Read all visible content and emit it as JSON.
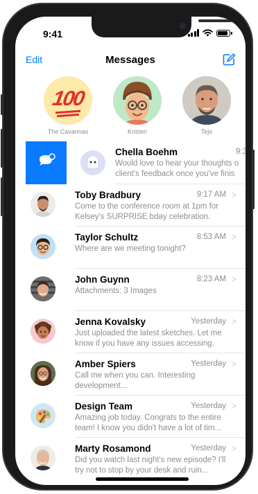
{
  "status": {
    "time": "9:41"
  },
  "nav": {
    "edit": "Edit",
    "title": "Messages"
  },
  "pins": [
    {
      "label": "The Cavannas",
      "emoji": "💯"
    },
    {
      "label": "Kristen"
    },
    {
      "label": "Tejo"
    }
  ],
  "swiped": {
    "name": "Chella Boehm",
    "time": "9:3",
    "preview_line1": "Would love to hear your thoughts o",
    "preview_line2": "client's feedback once you've finis"
  },
  "conversations": [
    {
      "name": "Toby Bradbury",
      "time": "9:17 AM",
      "preview": "Come to the conference room at 1pm for Kelsey's SURPRISE bday celebration."
    },
    {
      "name": "Taylor Schultz",
      "time": "8:53 AM",
      "preview": "Where are we meeting tonight?"
    },
    {
      "name": "John Guynn",
      "time": "8:23 AM",
      "preview": "Attachments: 3 Images"
    },
    {
      "name": "Jenna Kovalsky",
      "time": "Yesterday",
      "preview": "Just uploaded the latest sketches. Let me know if you have any issues accessing."
    },
    {
      "name": "Amber Spiers",
      "time": "Yesterday",
      "preview": "Call me when you can. Interesting development..."
    },
    {
      "name": "Design Team",
      "time": "Yesterday",
      "preview": "Amazing job today. Congrats to the entire team! I know you didn't have a lot of tim..."
    },
    {
      "name": "Marty Rosamond",
      "time": "Yesterday",
      "preview": "Did you watch last night's new episode? I'll try not to stop by your desk and ruin..."
    }
  ],
  "icons": {
    "chevron": ">",
    "compose": "compose-icon",
    "unread": "unread-bubble-icon"
  },
  "colors": {
    "accent": "#007aff",
    "swipe_action": "#0a7aff"
  }
}
